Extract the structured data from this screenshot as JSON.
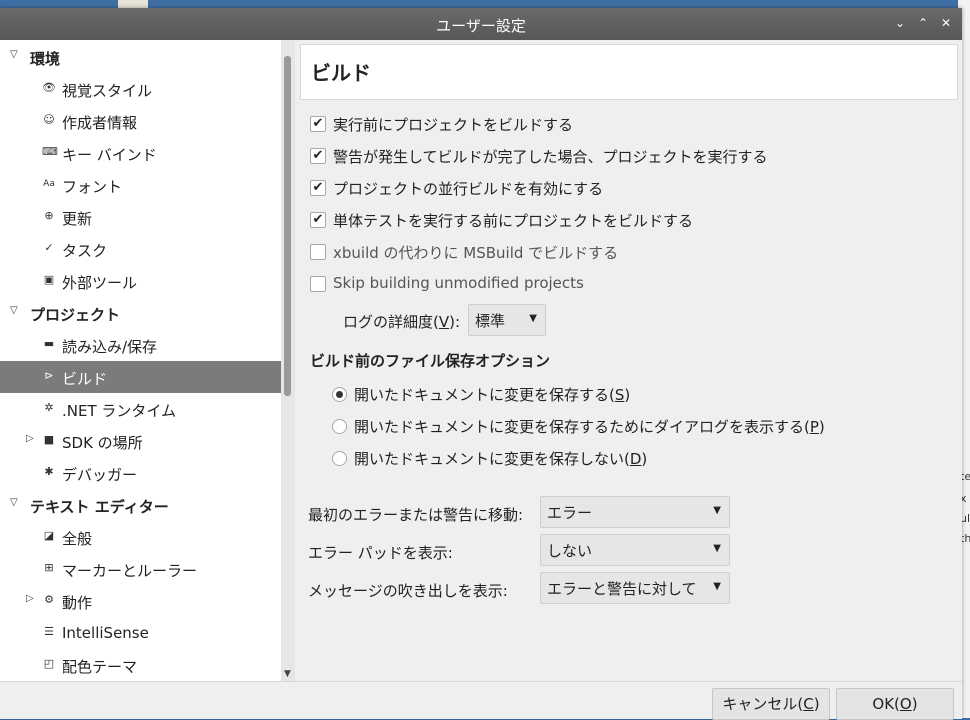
{
  "window": {
    "title": "ユーザー設定"
  },
  "sidebar": {
    "items": [
      {
        "label": "環境",
        "type": "category",
        "icon": "collapse-arrow-icon"
      },
      {
        "label": "視覚スタイル",
        "icon": "eye-icon"
      },
      {
        "label": "作成者情報",
        "icon": "smiley-icon"
      },
      {
        "label": "キー バインド",
        "icon": "keyboard-icon"
      },
      {
        "label": "フォント",
        "icon": "font-icon"
      },
      {
        "label": "更新",
        "icon": "update-icon"
      },
      {
        "label": "タスク",
        "icon": "check-icon"
      },
      {
        "label": "外部ツール",
        "icon": "terminal-icon"
      },
      {
        "label": "プロジェクト",
        "type": "category",
        "icon": "collapse-arrow-icon"
      },
      {
        "label": "読み込み/保存",
        "icon": "drive-icon"
      },
      {
        "label": "ビルド",
        "icon": "build-icon",
        "selected": true
      },
      {
        "label": ".NET ランタイム",
        "icon": "gear-icon"
      },
      {
        "label": "SDK の場所",
        "icon": "folder-icon",
        "expander": true
      },
      {
        "label": "デバッガー",
        "icon": "bug-icon"
      },
      {
        "label": "テキスト エディター",
        "type": "category",
        "icon": "collapse-arrow-icon"
      },
      {
        "label": "全般",
        "icon": "edit-icon"
      },
      {
        "label": "マーカーとルーラー",
        "icon": "grid-icon"
      },
      {
        "label": "動作",
        "icon": "behavior-icon",
        "expander": true
      },
      {
        "label": "IntelliSense",
        "icon": "list-icon"
      },
      {
        "label": "配色テーマ",
        "icon": "theme-icon"
      }
    ]
  },
  "main": {
    "title": "ビルド",
    "checkboxes": [
      {
        "label": "実行前にプロジェクトをビルドする",
        "checked": true
      },
      {
        "label": "警告が発生してビルドが完了した場合、プロジェクトを実行する",
        "checked": true
      },
      {
        "label": "プロジェクトの並行ビルドを有効にする",
        "checked": true
      },
      {
        "label": "単体テストを実行する前にプロジェクトをビルドする",
        "checked": true
      },
      {
        "label": "xbuild の代わりに MSBuild でビルドする",
        "checked": false
      },
      {
        "label": "Skip building unmodified projects",
        "checked": false
      }
    ],
    "log_label": "ログの詳細度(",
    "log_key": "V",
    "log_suffix": "):",
    "log_value": "標準",
    "save_section_title": "ビルド前のファイル保存オプション",
    "radios": [
      {
        "label": "開いたドキュメントに変更を保存する(",
        "key": "S",
        "suffix": ")",
        "selected": true
      },
      {
        "label": "開いたドキュメントに変更を保存するためにダイアログを表示する(",
        "key": "P",
        "suffix": ")",
        "selected": false
      },
      {
        "label": "開いたドキュメントに変更を保存しない(",
        "key": "D",
        "suffix": ")",
        "selected": false
      }
    ],
    "fields": [
      {
        "label": "最初のエラーまたは警告に移動:",
        "value": "エラー"
      },
      {
        "label": "エラー パッドを表示:",
        "value": "しない"
      },
      {
        "label": "メッセージの吹き出しを表示:",
        "value": "エラーと警告に対して"
      }
    ]
  },
  "buttons": {
    "cancel_label": "キャンセル(",
    "cancel_key": "C",
    "cancel_suffix": ")",
    "ok_label": "OK(",
    "ok_key": "O",
    "ok_suffix": ")"
  },
  "background_text": [
    "te",
    "x",
    "ul",
    "th"
  ]
}
